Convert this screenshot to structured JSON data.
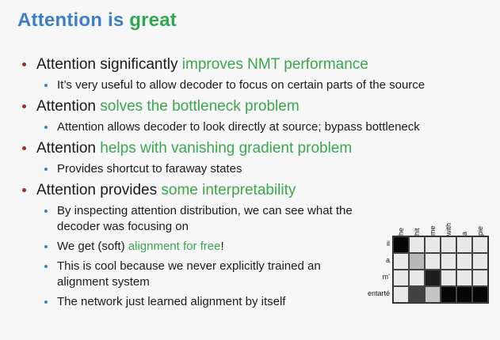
{
  "title": {
    "part1": "Attention is",
    "part2": "great"
  },
  "bullets": [
    {
      "main_plain": "Attention significantly ",
      "main_hl": "improves NMT performance",
      "subs": [
        {
          "plain": "It’s very useful to allow decoder to focus on certain parts of the source",
          "hl": "",
          "tail": ""
        }
      ]
    },
    {
      "main_plain": "Attention ",
      "main_hl": "solves the bottleneck problem",
      "subs": [
        {
          "plain": "Attention allows decoder to look directly at source; bypass bottleneck",
          "hl": "",
          "tail": ""
        }
      ]
    },
    {
      "main_plain": "Attention ",
      "main_hl": "helps with vanishing gradient problem",
      "subs": [
        {
          "plain": "Provides shortcut to faraway states",
          "hl": "",
          "tail": ""
        }
      ]
    },
    {
      "main_plain": "Attention provides ",
      "main_hl": "some interpretability",
      "subs": [
        {
          "plain": "By inspecting attention distribution, we can see what the decoder was focusing on",
          "hl": "",
          "tail": ""
        },
        {
          "plain": "We get (soft) ",
          "hl": "alignment for free",
          "tail": "!"
        },
        {
          "plain": "This is cool because we never explicitly trained an alignment system",
          "hl": "",
          "tail": ""
        },
        {
          "plain": "The network just learned alignment by itself",
          "hl": "",
          "tail": ""
        }
      ]
    }
  ],
  "alignment_matrix": {
    "columns": [
      "he",
      "hit",
      "me",
      "with",
      "a",
      "pie"
    ],
    "rows": [
      "il",
      "a",
      "m’",
      "entarté"
    ],
    "weights": [
      [
        1.0,
        0.05,
        0.05,
        0.05,
        0.05,
        0.05
      ],
      [
        0.05,
        0.25,
        0.05,
        0.05,
        0.05,
        0.05
      ],
      [
        0.05,
        0.05,
        0.9,
        0.05,
        0.05,
        0.05
      ],
      [
        0.05,
        0.75,
        0.2,
        1.0,
        1.0,
        1.0
      ]
    ]
  },
  "colors": {
    "title_blue": "#3a7fc8",
    "highlight_green": "#3aa64d",
    "bullet_red": "#a32b2b"
  }
}
